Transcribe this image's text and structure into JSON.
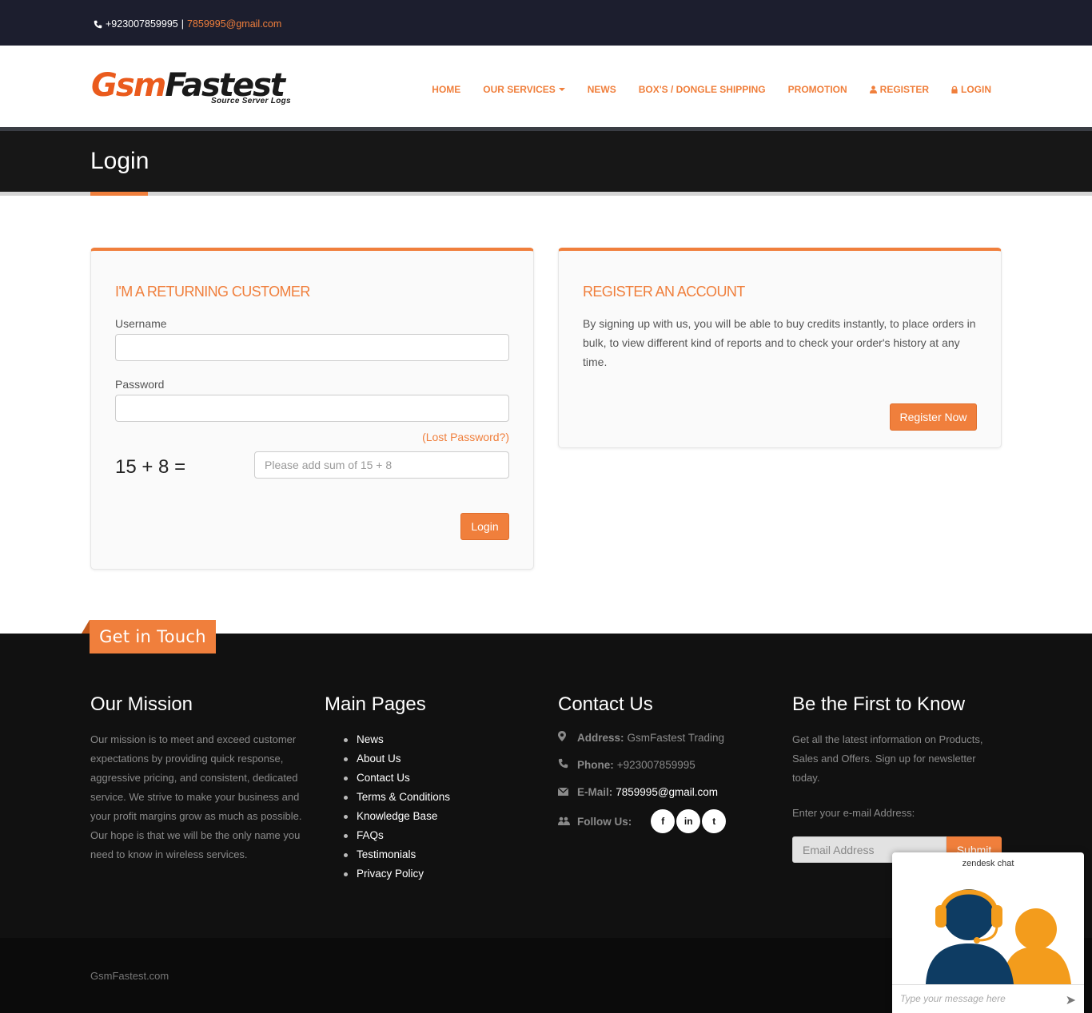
{
  "topbar": {
    "phone": "+923007859995",
    "separator": "|",
    "email": "7859995@gmail.com"
  },
  "logo": {
    "part1": "Gsm",
    "part2": "Fastest",
    "tagline": "Source Server Logs"
  },
  "nav": {
    "home": "HOME",
    "services": "OUR SERVICES",
    "news": "NEWS",
    "shipping": "BOX'S / DONGLE SHIPPING",
    "promotion": "PROMOTION",
    "register": "REGISTER",
    "login": "LOGIN"
  },
  "page_title": "Login",
  "login_panel": {
    "heading": "I'M A RETURNING CUSTOMER",
    "username_label": "Username",
    "password_label": "Password",
    "lost_password": "(Lost Password?)",
    "captcha_question": "15 + 8 =",
    "captcha_placeholder": "Please add sum of 15 + 8",
    "login_button": "Login"
  },
  "register_panel": {
    "heading": "REGISTER AN ACCOUNT",
    "text": "By signing up with us, you will be able to buy credits instantly, to place orders in bulk, to view different kind of reports and to check your order's history at any time.",
    "button": "Register Now"
  },
  "footer": {
    "badge": "Get in Touch",
    "mission": {
      "title": "Our Mission",
      "text": "Our mission is to meet and exceed customer expectations by providing quick response, aggressive pricing, and consistent, dedicated service. We strive to make your business and your profit margins grow as much as possible. Our hope is that we will be the only name you need to know in wireless services."
    },
    "pages": {
      "title": "Main Pages",
      "items": [
        "News",
        "About Us",
        "Contact Us",
        "Terms & Conditions",
        "Knowledge Base",
        "FAQs",
        "Testimonials",
        "Privacy Policy"
      ]
    },
    "contact": {
      "title": "Contact Us",
      "address_label": "Address:",
      "address": "GsmFastest Trading",
      "phone_label": "Phone:",
      "phone": "+923007859995",
      "email_label": "E-Mail:",
      "email": "7859995@gmail.com",
      "follow_label": "Follow Us:",
      "social": [
        "f",
        "in",
        "t"
      ]
    },
    "newsletter": {
      "title": "Be the First to Know",
      "text": "Get all the latest information on Products, Sales and Offers. Sign up for newsletter today.",
      "enter_label": "Enter your e-mail Address:",
      "placeholder": "Email Address",
      "button": "Submit"
    },
    "copyright": "GsmFastest.com"
  },
  "chat": {
    "title": "zendesk chat",
    "placeholder": "Type your message here"
  },
  "colors": {
    "accent": "#f07f3c",
    "dark": "#171717",
    "topbar": "#1c1e2e"
  }
}
